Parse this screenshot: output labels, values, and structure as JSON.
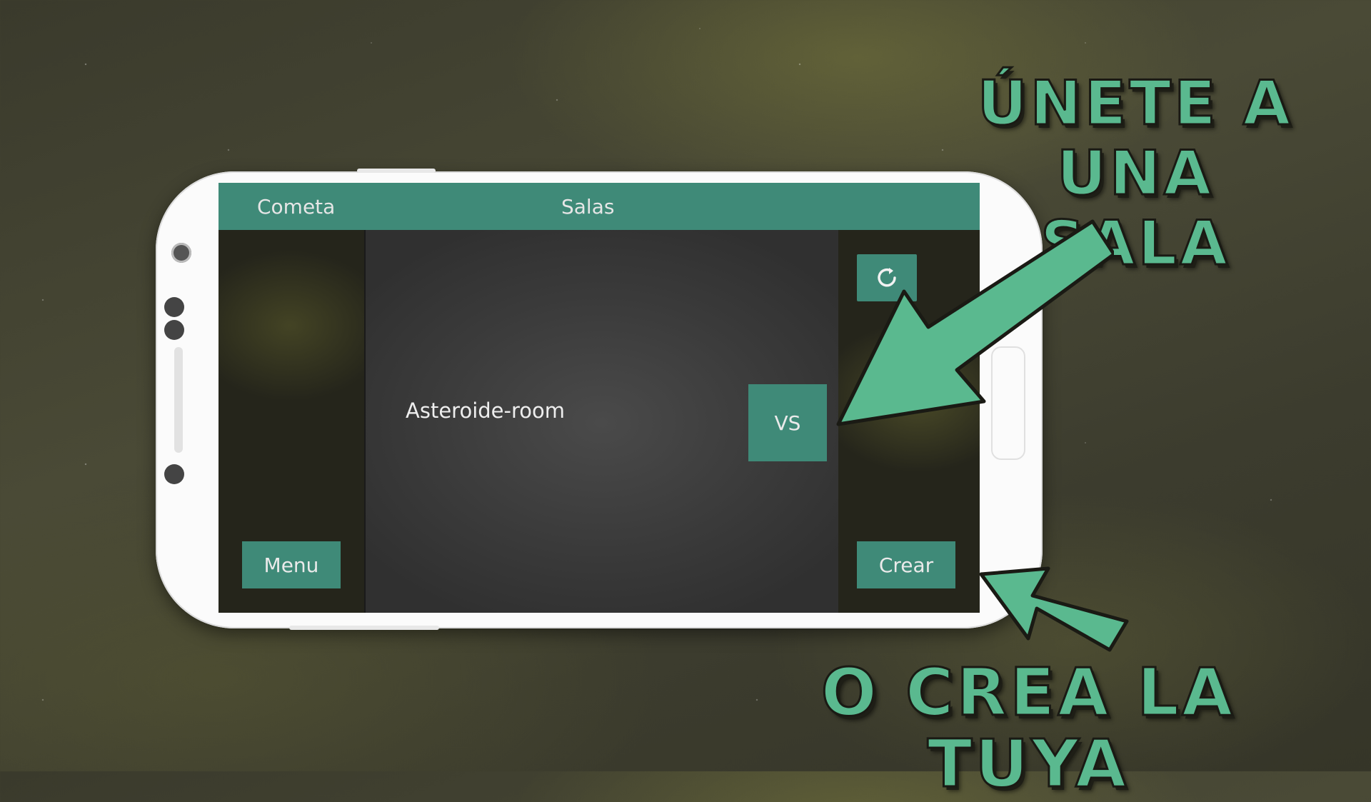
{
  "app": {
    "name": "Cometa",
    "screen_title": "Salas"
  },
  "rooms": [
    {
      "name": "Asteroide-room",
      "mode_label": "VS"
    }
  ],
  "buttons": {
    "refresh_icon": "refresh-icon",
    "menu_label": "Menu",
    "create_label": "Crear"
  },
  "promo": {
    "join_line1": "ÚNETE A UNA",
    "join_line2": "SALA",
    "create": "O CREA LA TUYA"
  },
  "colors": {
    "accent": "#3f8a78",
    "promo_green": "#5ab98f"
  }
}
